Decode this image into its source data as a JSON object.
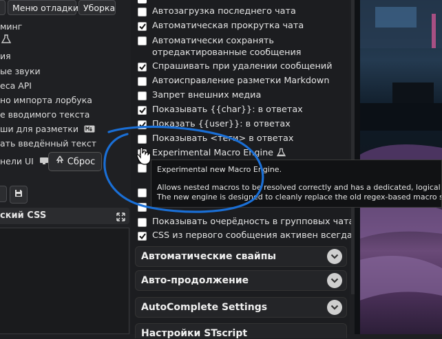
{
  "left": {
    "top_buttons": [
      "Меню отладки",
      "Уборка"
    ],
    "rows": [
      "минг",
      "ия",
      "ые звуки",
      "еса API",
      "но импорта лорбука",
      "е вводимого текста",
      "ши для разметки",
      "ать введённый текст",
      "нели UI"
    ],
    "reset_label": "Сброс",
    "css_title": "ский CSS"
  },
  "settings": {
    "items": [
      {
        "label": "Автозагрузка последнего чата",
        "checked": false
      },
      {
        "label": "Автоматическая прокрутка чата",
        "checked": true
      },
      {
        "label": "Автоматически сохранять",
        "label2": "отредактированные сообщения",
        "checked": false
      },
      {
        "label": "Спрашивать при удалении сообщений",
        "checked": true
      },
      {
        "label": "Автоисправление разметки Markdown",
        "checked": false
      },
      {
        "label": "Запрет внешних медиа",
        "checked": false
      },
      {
        "label": "Показывать {{char}}: в ответах",
        "checked": true
      },
      {
        "label": "Показать {{user}}: в ответах",
        "checked": true
      },
      {
        "label": "Показывать <теги> в ответах",
        "checked": false
      },
      {
        "label": "Experimental Macro Engine",
        "checked": true
      },
      {
        "label": "Показывать очерёдность в групповых чатах",
        "checked": false
      },
      {
        "label": "CSS из первого сообщения активен всегда",
        "checked": true
      }
    ],
    "sections": [
      "Автоматические свайпы",
      "Авто-продолжение",
      "AutoComplete Settings",
      "Настройки STscript"
    ]
  },
  "tooltip": {
    "line1": "Experimental new Macro Engine.",
    "line2": "Allows nested macros to be resolved correctly and has a dedicated, logical repl",
    "line3": "The new engine is designed to cleanly replace the old regex-based macro syste"
  },
  "colors": {
    "annotation": "#1a6fd6",
    "accent": "#f0f0f0"
  }
}
